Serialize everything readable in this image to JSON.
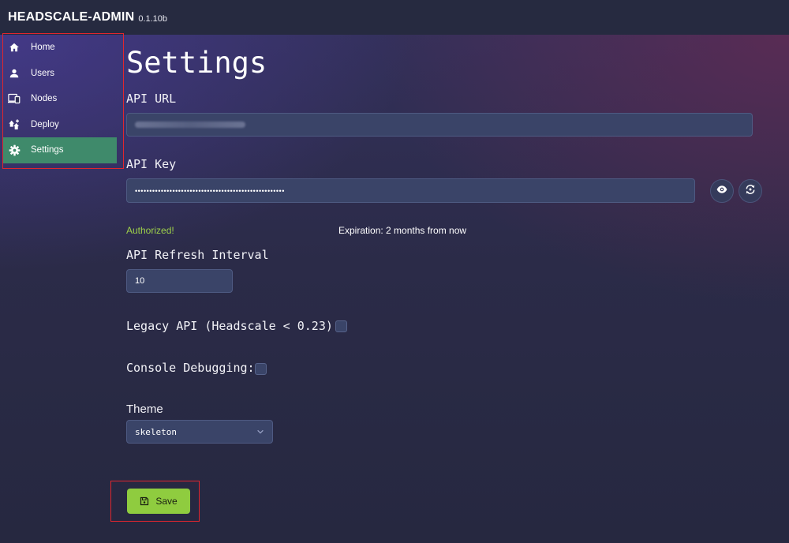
{
  "header": {
    "brand": "HEADSCALE-ADMIN",
    "version": "0.1.10b"
  },
  "sidebar": {
    "items": [
      {
        "label": "Home",
        "icon": "home-icon"
      },
      {
        "label": "Users",
        "icon": "user-icon"
      },
      {
        "label": "Nodes",
        "icon": "devices-icon"
      },
      {
        "label": "Deploy",
        "icon": "deploy-icon"
      },
      {
        "label": "Settings",
        "icon": "gear-icon",
        "active": true
      }
    ]
  },
  "settings": {
    "title": "Settings",
    "api_url": {
      "label": "API URL",
      "value": ""
    },
    "api_key": {
      "label": "API Key",
      "value": "••••••••••••••••••••••••••••••••••••••••••••••••••••"
    },
    "status": {
      "authorized": "Authorized!",
      "expiration": "Expiration: 2 months from now"
    },
    "refresh_interval": {
      "label": "API Refresh Interval",
      "value": "10"
    },
    "legacy_api": {
      "label": "Legacy API (Headscale < 0.23):",
      "checked": false
    },
    "console_debugging": {
      "label": "Console Debugging:",
      "checked": false
    },
    "theme": {
      "label": "Theme",
      "selected": "skeleton"
    },
    "save_label": "Save"
  },
  "colors": {
    "accent_green": "#8fcc3f",
    "active_nav": "#3f8a6b",
    "authorized_text": "#9ed04a",
    "highlight_box": "#e0262e"
  }
}
